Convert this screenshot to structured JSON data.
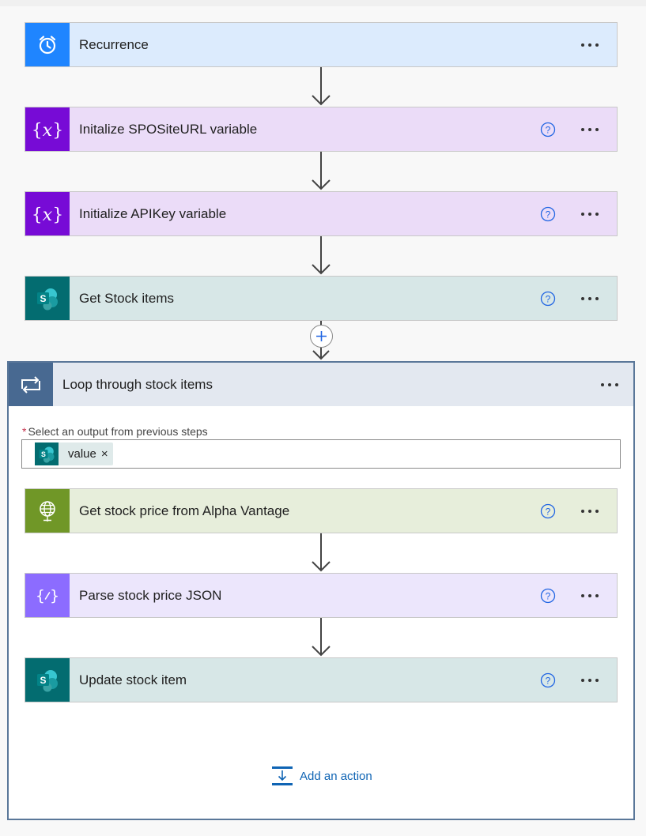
{
  "steps": [
    {
      "title": "Recurrence",
      "icon": "alarm-clock-icon"
    },
    {
      "title": "Initalize SPOSiteURL variable",
      "icon": "variable-icon"
    },
    {
      "title": "Initialize APIKey variable",
      "icon": "variable-icon"
    },
    {
      "title": "Get Stock items",
      "icon": "sharepoint-icon"
    }
  ],
  "loop": {
    "title": "Loop through stock items",
    "output_label": "Select an output from previous steps",
    "required_marker": "*",
    "token": {
      "label": "value",
      "remove": "×"
    },
    "actions": [
      {
        "title": "Get stock price from Alpha Vantage",
        "icon": "http-globe-icon"
      },
      {
        "title": "Parse stock price JSON",
        "icon": "json-parse-icon"
      },
      {
        "title": "Update stock item",
        "icon": "sharepoint-icon"
      }
    ],
    "add_action_label": "Add an action"
  },
  "colors": {
    "recurrence": "#1f85ff",
    "variable": "#770bd6",
    "sharepoint": "#036c70",
    "http": "#709727",
    "parse_json": "#8c6cff",
    "loop": "#486991",
    "link": "#0f64b4"
  }
}
